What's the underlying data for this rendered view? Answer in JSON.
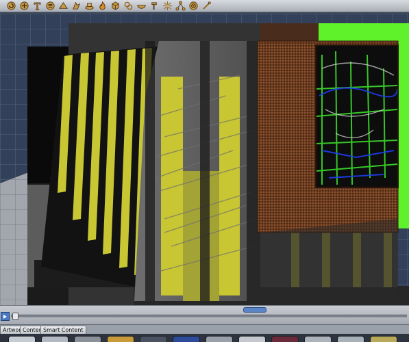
{
  "toolbar": {
    "icons": [
      "rotate-icon",
      "translate-icon",
      "text-icon",
      "grid-icon",
      "bend-icon",
      "morph-icon",
      "taper-icon",
      "flame-icon",
      "cube-icon",
      "link-icon",
      "bowl-icon",
      "hammer-icon",
      "sparkle-icon",
      "network-icon",
      "target-icon",
      "wand-icon"
    ]
  },
  "tabs": {
    "artwork": "Artwork",
    "content": "Content",
    "smart_content": "Smart Content"
  },
  "colors": {
    "accent": "#4a78c4",
    "yellow": "#c8c632",
    "green": "#5ff22a",
    "brown": "#6b3a1e"
  }
}
